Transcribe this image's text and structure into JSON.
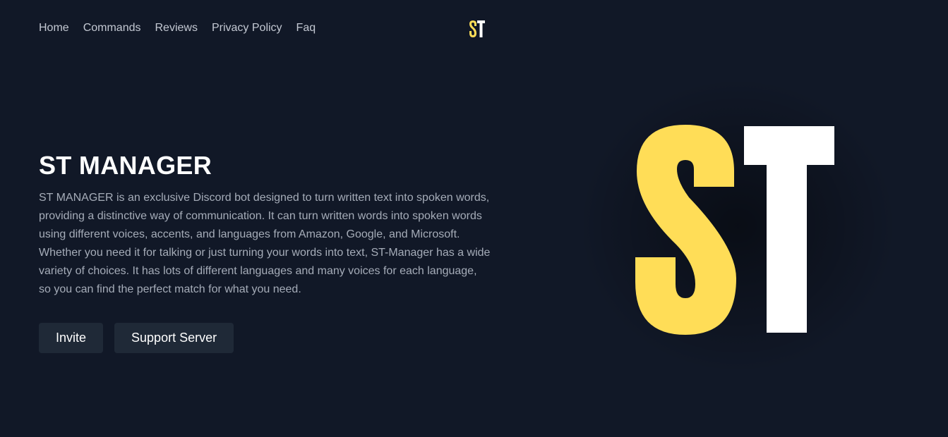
{
  "nav": {
    "items": [
      {
        "label": "Home"
      },
      {
        "label": "Commands"
      },
      {
        "label": "Reviews"
      },
      {
        "label": "Privacy Policy"
      },
      {
        "label": "Faq"
      }
    ]
  },
  "logo": {
    "letters": "ST",
    "colors": {
      "s": "#FFDD57",
      "t": "#FFFFFF"
    }
  },
  "hero": {
    "title": "ST MANAGER",
    "description": "ST MANAGER is an exclusive Discord bot designed to turn written text into spoken words, providing a distinctive way of communication. It can turn written words into spoken words using different voices, accents, and languages from Amazon, Google, and Microsoft. Whether you need it for talking or just turning your words into text, ST-Manager has a wide variety of choices. It has lots of different languages and many voices for each language, so you can find the perfect match for what you need."
  },
  "buttons": {
    "invite": "Invite",
    "support": "Support Server"
  },
  "theme": {
    "background": "#111827",
    "button_bg": "#1F2937",
    "accent_yellow": "#FFDD57"
  }
}
